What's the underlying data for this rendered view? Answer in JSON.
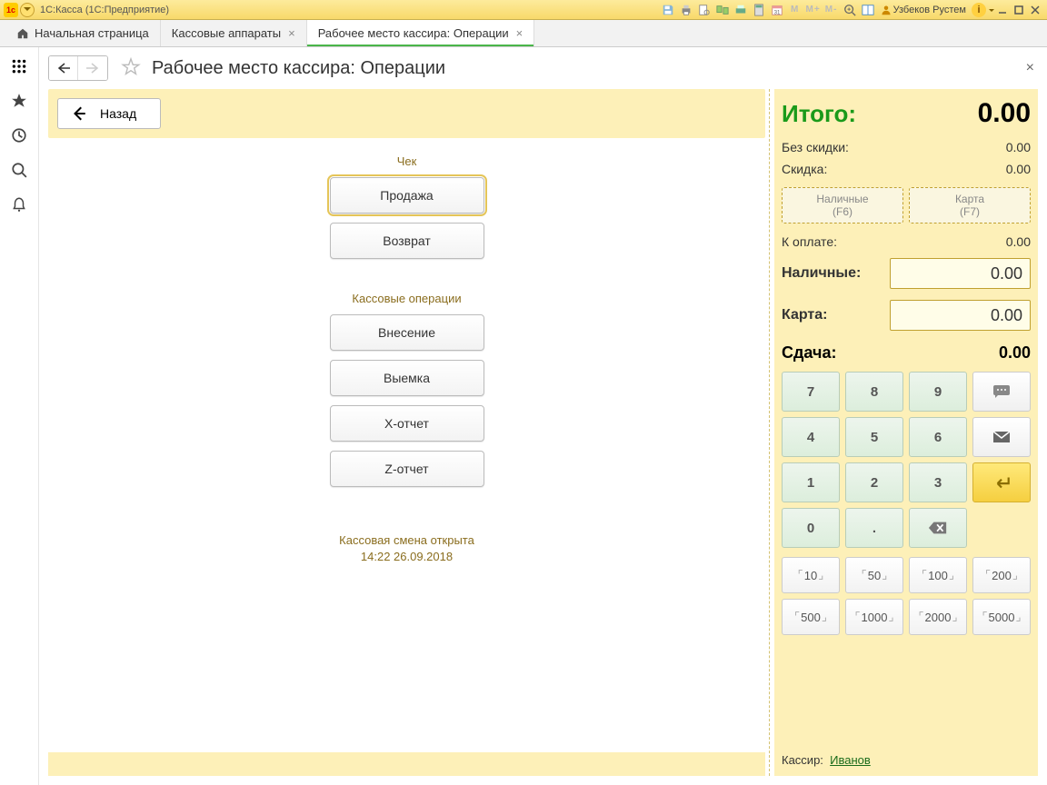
{
  "titlebar": {
    "title": "1С:Касса  (1С:Предприятие)",
    "m": "M",
    "mplus": "M+",
    "mminus": "M-",
    "user": "Узбеков Рустем"
  },
  "tabs": {
    "home": "Начальная страница",
    "t1": "Кассовые аппараты",
    "t2": "Рабочее место кассира: Операции"
  },
  "page": {
    "title": "Рабочее место кассира: Операции",
    "back": "Назад"
  },
  "ops": {
    "check_sect": "Чек",
    "sale": "Продажа",
    "return": "Возврат",
    "cash_sect": "Кассовые операции",
    "deposit": "Внесение",
    "withdraw": "Выемка",
    "xreport": "X-отчет",
    "zreport": "Z-отчет",
    "shift1": "Кассовая смена открыта",
    "shift2": "14:22 26.09.2018"
  },
  "right": {
    "itogo_lbl": "Итого:",
    "itogo_val": "0.00",
    "nodisc_lbl": "Без скидки:",
    "nodisc_val": "0.00",
    "disc_lbl": "Скидка:",
    "disc_val": "0.00",
    "cash_btn1": "Наличные",
    "cash_btn1_hint": "(F6)",
    "card_btn1": "Карта",
    "card_btn1_hint": "(F7)",
    "topay_lbl": "К оплате:",
    "topay_val": "0.00",
    "cash_lbl": "Наличные:",
    "cash_val": "0.00",
    "card_lbl": "Карта:",
    "card_val": "0.00",
    "change_lbl": "Сдача:",
    "change_val": "0.00",
    "k7": "7",
    "k8": "8",
    "k9": "9",
    "k4": "4",
    "k5": "5",
    "k6": "6",
    "k1": "1",
    "k2": "2",
    "k3": "3",
    "k0": "0",
    "kdot": ".",
    "d10": "10",
    "d50": "50",
    "d100": "100",
    "d200": "200",
    "d500": "500",
    "d1000": "1000",
    "d2000": "2000",
    "d5000": "5000",
    "cashier_lbl": "Кассир:",
    "cashier_name": "Иванов"
  }
}
